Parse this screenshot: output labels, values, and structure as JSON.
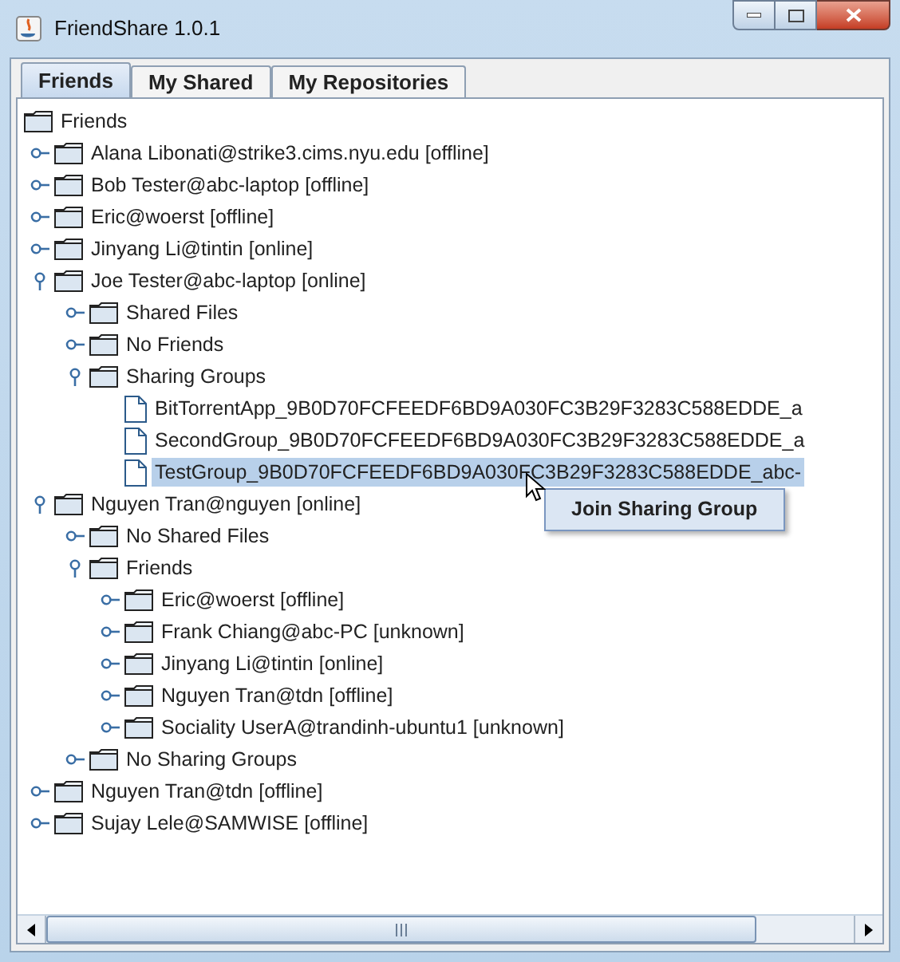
{
  "window": {
    "title": "FriendShare 1.0.1"
  },
  "tabs": [
    {
      "label": "Friends",
      "selected": true
    },
    {
      "label": "My Shared",
      "selected": false
    },
    {
      "label": "My Repositories",
      "selected": false
    }
  ],
  "tree": {
    "label": "Friends",
    "kind": "root",
    "children": [
      {
        "label": "Alana Libonati@strike3.cims.nyu.edu [offline]",
        "kind": "folder",
        "expanded": false
      },
      {
        "label": "Bob Tester@abc-laptop [offline]",
        "kind": "folder",
        "expanded": false
      },
      {
        "label": "Eric@woerst [offline]",
        "kind": "folder",
        "expanded": false
      },
      {
        "label": "Jinyang Li@tintin [online]",
        "kind": "folder",
        "expanded": false
      },
      {
        "label": "Joe Tester@abc-laptop [online]",
        "kind": "folder",
        "expanded": true,
        "children": [
          {
            "label": "Shared Files",
            "kind": "folder",
            "expanded": false
          },
          {
            "label": "No Friends",
            "kind": "folder",
            "expanded": false
          },
          {
            "label": "Sharing Groups",
            "kind": "folder",
            "expanded": true,
            "children": [
              {
                "label": "BitTorrentApp_9B0D70FCFEEDF6BD9A030FC3B29F3283C588EDDE_a",
                "kind": "file",
                "selected": false
              },
              {
                "label": "SecondGroup_9B0D70FCFEEDF6BD9A030FC3B29F3283C588EDDE_a",
                "kind": "file",
                "selected": false
              },
              {
                "label": "TestGroup_9B0D70FCFEEDF6BD9A030FC3B29F3283C588EDDE_abc-",
                "kind": "file",
                "selected": true
              }
            ]
          }
        ]
      },
      {
        "label": "Nguyen Tran@nguyen [online]",
        "kind": "folder",
        "expanded": true,
        "children": [
          {
            "label": "No Shared Files",
            "kind": "folder",
            "expanded": false
          },
          {
            "label": "Friends",
            "kind": "folder",
            "expanded": true,
            "children": [
              {
                "label": "Eric@woerst [offline]",
                "kind": "folder",
                "expanded": false
              },
              {
                "label": "Frank Chiang@abc-PC [unknown]",
                "kind": "folder",
                "expanded": false
              },
              {
                "label": "Jinyang Li@tintin [online]",
                "kind": "folder",
                "expanded": false
              },
              {
                "label": "Nguyen Tran@tdn [offline]",
                "kind": "folder",
                "expanded": false
              },
              {
                "label": "Sociality UserA@trandinh-ubuntu1 [unknown]",
                "kind": "folder",
                "expanded": false
              }
            ]
          },
          {
            "label": "No Sharing Groups",
            "kind": "folder",
            "expanded": false
          }
        ]
      },
      {
        "label": "Nguyen Tran@tdn [offline]",
        "kind": "folder",
        "expanded": false
      },
      {
        "label": "Sujay Lele@SAMWISE [offline]",
        "kind": "folder",
        "expanded": false
      }
    ]
  },
  "context_menu": {
    "items": [
      "Join Sharing Group"
    ]
  }
}
